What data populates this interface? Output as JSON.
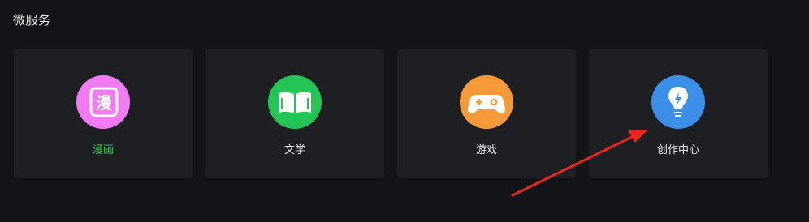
{
  "section": {
    "title": "微服务"
  },
  "services": [
    {
      "id": "manga",
      "label": "漫画",
      "icon": "manga-icon",
      "icon_glyph": "漫",
      "color": "#f07bf2",
      "active": true
    },
    {
      "id": "literature",
      "label": "文学",
      "icon": "open-book-icon",
      "color": "#23c655",
      "active": false
    },
    {
      "id": "games",
      "label": "游戏",
      "icon": "gamepad-icon",
      "color": "#f79b3a",
      "active": false
    },
    {
      "id": "creation",
      "label": "创作中心",
      "icon": "lightbulb-icon",
      "color": "#3b8fe8",
      "active": false
    }
  ],
  "annotation": {
    "type": "red-arrow",
    "color": "#e8261f",
    "points_to": "creation-center"
  }
}
